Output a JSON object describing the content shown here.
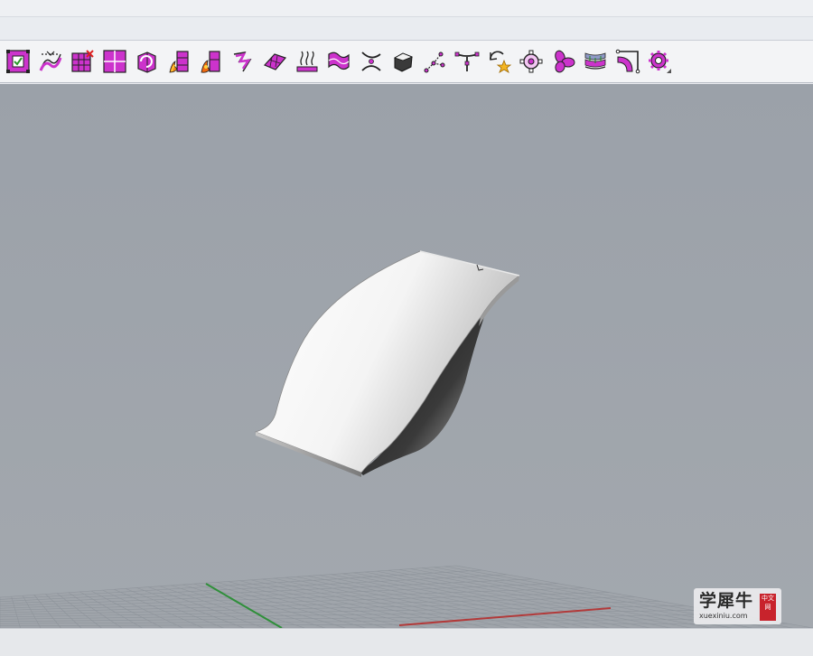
{
  "toolbar": {
    "tools": [
      {
        "icon": "surface-check-icon"
      },
      {
        "icon": "split-surface-icon"
      },
      {
        "icon": "delete-surface-grid-icon"
      },
      {
        "icon": "surface-grid-icon"
      },
      {
        "icon": "rebuild-surface-icon"
      },
      {
        "icon": "heat-surface-icon"
      },
      {
        "icon": "heat-surface-alt-icon"
      },
      {
        "icon": "fold-surface-icon"
      },
      {
        "icon": "patch-surface-icon"
      },
      {
        "icon": "extrude-curves-icon"
      },
      {
        "icon": "wavy-surface-icon"
      },
      {
        "icon": "intersect-icon"
      },
      {
        "icon": "solid-box-icon"
      },
      {
        "icon": "point-network-icon"
      },
      {
        "icon": "branch-curve-icon"
      },
      {
        "icon": "refresh-star-icon"
      },
      {
        "icon": "target-control-icon"
      },
      {
        "icon": "petal-shape-icon"
      },
      {
        "icon": "layered-surface-icon"
      },
      {
        "icon": "bend-frame-icon"
      },
      {
        "icon": "gear-settings-icon"
      }
    ],
    "accent_color": "#cc33cc"
  },
  "viewport": {
    "background_color": "#9aa0a8",
    "grid_visible": true,
    "x_axis_color": "#b23a3a",
    "y_axis_color": "#2f8f3a"
  },
  "watermark": {
    "main": "学犀牛",
    "sub": "xuexiniu.com",
    "seal": "中文网"
  }
}
